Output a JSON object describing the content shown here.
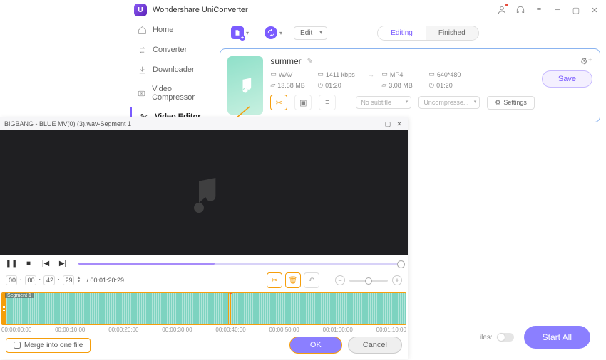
{
  "app": {
    "title": "Wondershare UniConverter"
  },
  "sidebar": {
    "items": [
      {
        "label": "Home",
        "icon": "home"
      },
      {
        "label": "Converter",
        "icon": "convert"
      },
      {
        "label": "Downloader",
        "icon": "download"
      },
      {
        "label": "Video Compressor",
        "icon": "compress"
      },
      {
        "label": "Video Editor",
        "icon": "scissors"
      }
    ]
  },
  "toolbar": {
    "mode_label": "Edit",
    "tabs": {
      "editing": "Editing",
      "finished": "Finished"
    }
  },
  "media": {
    "title": "summer",
    "source": {
      "format": "WAV",
      "bitrate": "1411 kbps",
      "size": "13.58 MB",
      "duration": "01:20"
    },
    "target": {
      "format": "MP4",
      "resolution": "640*480",
      "size": "3.08 MB",
      "duration": "01:20"
    },
    "save_label": "Save",
    "subtitle_label": "No subtitle",
    "compress_label": "Uncompresse...",
    "settings_label": "Settings"
  },
  "bottom": {
    "toggle_label": "iles:",
    "start_all": "Start All"
  },
  "editor": {
    "window_title": "BIGBANG - BLUE MV(0) (3).wav-Segment 1",
    "current_time": {
      "h": "00",
      "m": "00",
      "s": "42",
      "f": "29"
    },
    "total_time": "/ 00:01:20:29",
    "segment_label": "Segment 1",
    "timescale": [
      "00:00:00:00",
      "00:00:10:00",
      "00:00:20:00",
      "00:00:30:00",
      "00:00:40:00",
      "00:00:50:00",
      "00:01:00:00",
      "00:01:10:00"
    ],
    "merge_label": "Merge into one file",
    "ok_label": "OK",
    "cancel_label": "Cancel"
  }
}
